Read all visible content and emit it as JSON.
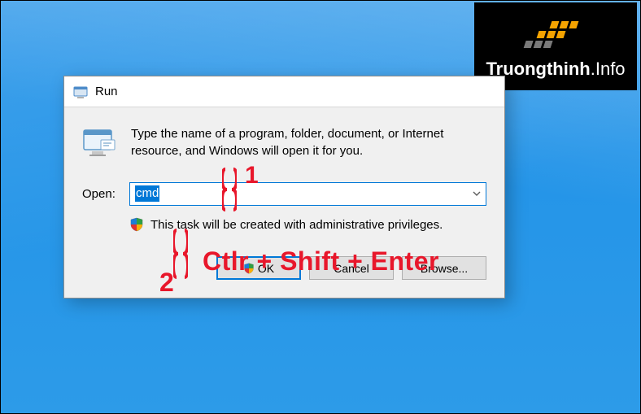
{
  "watermark": {
    "text_prefix": "Truongthinh",
    "text_suffix": ".Info"
  },
  "dialog": {
    "title": "Run",
    "description": "Type the name of a program, folder, document, or Internet resource, and Windows will open it for you.",
    "open_label": "Open:",
    "input_value": "cmd",
    "admin_text": "This task will be created with administrative privileges.",
    "buttons": {
      "ok": "OK",
      "cancel": "Cancel",
      "browse": "Browse..."
    }
  },
  "annotations": {
    "step1": "1",
    "step2": "2",
    "shortcut": "Ctlr + Shift + Enter"
  }
}
